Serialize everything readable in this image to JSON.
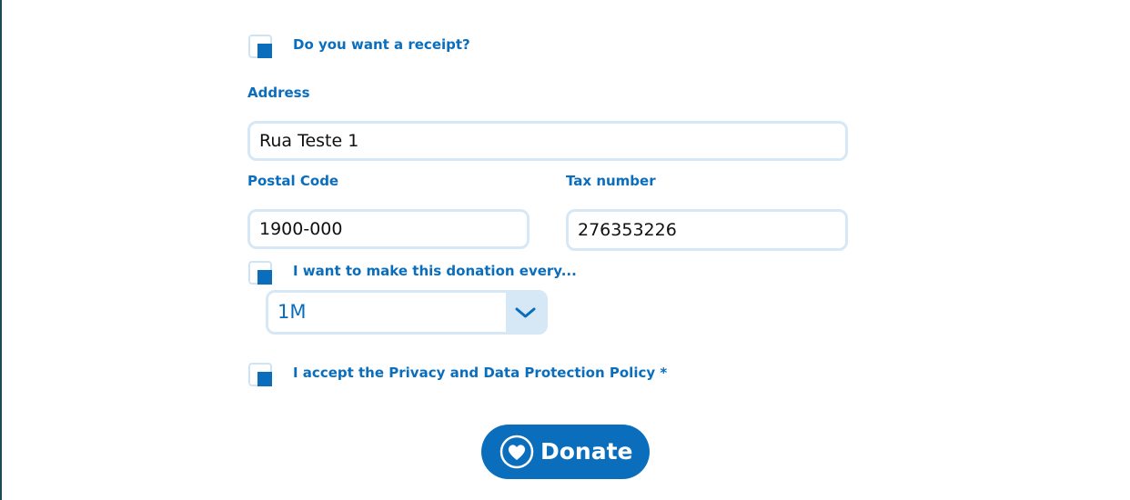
{
  "receipt": {
    "label": "Do you want a receipt?",
    "checked": true
  },
  "address": {
    "label": "Address",
    "value": "Rua Teste 1"
  },
  "postal_code": {
    "label": "Postal Code",
    "value": "1900-000"
  },
  "tax_number": {
    "label": "Tax number",
    "value": "276353226"
  },
  "recurring": {
    "label": "I want to make this donation every...",
    "checked": true,
    "frequency": "1M"
  },
  "privacy": {
    "label": "I accept the Privacy and Data Protection Policy *",
    "checked": true
  },
  "donate_button": {
    "label": "Donate",
    "icon": "heart-icon"
  },
  "colors": {
    "accent": "#0a6ebd",
    "field_border": "#d6e8f5"
  }
}
